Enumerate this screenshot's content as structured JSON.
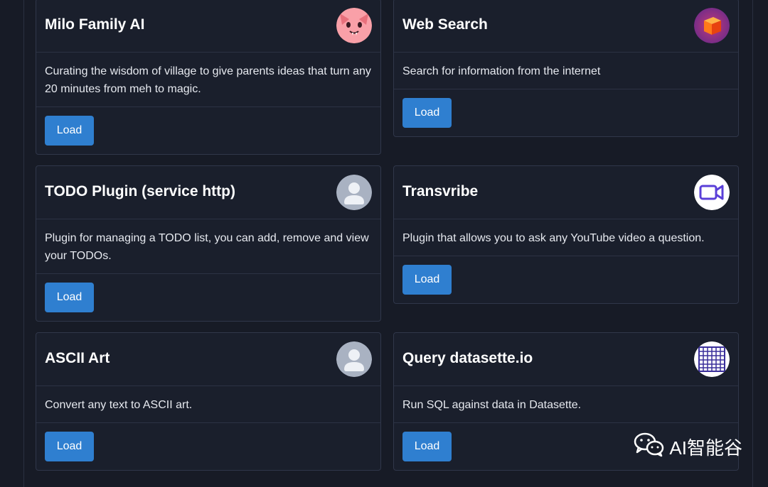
{
  "plugins": [
    {
      "title": "Milo Family AI",
      "description": "Curating the wisdom of village to give parents ideas that turn any 20 minutes from meh to magic.",
      "button_label": "Load",
      "icon": "cat-face-icon"
    },
    {
      "title": "Web Search",
      "description": "Search for information from the internet",
      "button_label": "Load",
      "icon": "cube-icon"
    },
    {
      "title": "TODO Plugin (service http)",
      "description": "Plugin for managing a TODO list, you can add, remove and view your TODOs.",
      "button_label": "Load",
      "icon": "default-avatar-icon"
    },
    {
      "title": "Transvribe",
      "description": "Plugin that allows you to ask any YouTube video a question.",
      "button_label": "Load",
      "icon": "video-camera-icon"
    },
    {
      "title": "ASCII Art",
      "description": "Convert any text to ASCII art.",
      "button_label": "Load",
      "icon": "default-avatar-icon"
    },
    {
      "title": "Query datasette.io",
      "description": "Run SQL against data in Datasette.",
      "button_label": "Load",
      "icon": "grid-table-icon"
    }
  ],
  "watermark": {
    "text": "AI智能谷",
    "icon": "wechat-icon"
  },
  "colors": {
    "background": "#171b26",
    "card": "#1a1f2c",
    "button": "#2f7fd0"
  }
}
